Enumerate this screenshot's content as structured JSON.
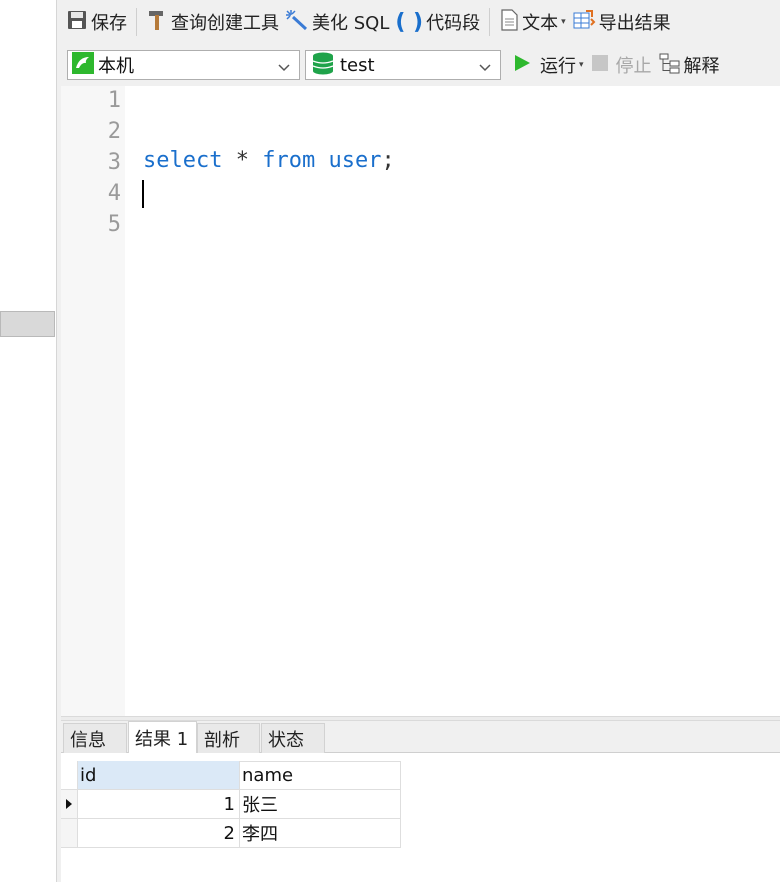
{
  "toolbar": {
    "save": "保存",
    "query_builder": "查询创建工具",
    "beautify": "美化 SQL",
    "snippet": "代码段",
    "text": "文本",
    "export": "导出结果"
  },
  "connection_bar": {
    "connection": "本机",
    "database": "test",
    "run": "运行",
    "stop": "停止",
    "explain": "解释"
  },
  "editor": {
    "line_numbers": [
      "1",
      "2",
      "3",
      "4",
      "5"
    ],
    "sql": {
      "kw1": "select",
      "star": " * ",
      "kw2": "from",
      "space": " ",
      "table": "user",
      "semi": ";"
    }
  },
  "result_tabs": [
    "信息",
    "结果 1",
    "剖析",
    "状态"
  ],
  "result_grid": {
    "columns": [
      "id",
      "name"
    ],
    "rows": [
      {
        "id": "1",
        "name": "张三"
      },
      {
        "id": "2",
        "name": "李四"
      }
    ]
  },
  "colors": {
    "keyword": "#1a6fcc",
    "run_green": "#2eb82e",
    "db_green": "#1fa34a"
  }
}
